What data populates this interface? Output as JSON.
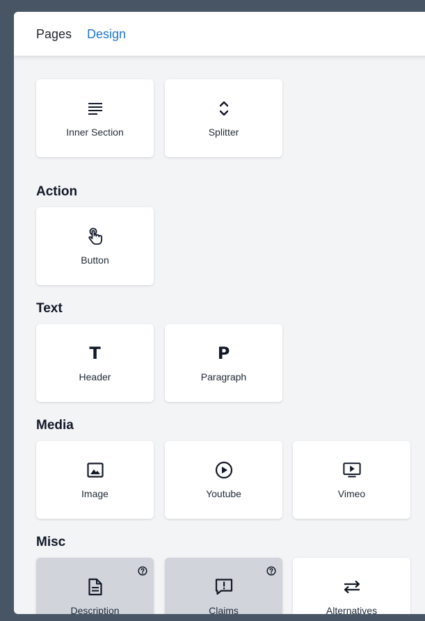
{
  "tabs": {
    "pages": "Pages",
    "design": "Design"
  },
  "colors": {
    "accent": "#1f77d0",
    "card_bg": "#ffffff",
    "card_shaded": "#d1d5db",
    "panel_bg": "#f3f4f6"
  },
  "layout_section": {
    "items": [
      {
        "label": "Inner Section",
        "icon": "lines-icon"
      },
      {
        "label": "Splitter",
        "icon": "expand-vertical-icon"
      }
    ]
  },
  "action_section": {
    "title": "Action",
    "items": [
      {
        "label": "Button",
        "icon": "pointer-hand-icon"
      }
    ]
  },
  "text_section": {
    "title": "Text",
    "items": [
      {
        "label": "Header",
        "icon": "letter-t-icon",
        "glyph": "T"
      },
      {
        "label": "Paragraph",
        "icon": "letter-p-icon",
        "glyph": "P"
      }
    ]
  },
  "media_section": {
    "title": "Media",
    "items": [
      {
        "label": "Image",
        "icon": "image-icon"
      },
      {
        "label": "Youtube",
        "icon": "play-circle-icon"
      },
      {
        "label": "Vimeo",
        "icon": "screen-play-icon"
      }
    ]
  },
  "misc_section": {
    "title": "Misc",
    "items": [
      {
        "label": "Description",
        "icon": "document-icon",
        "has_help": true
      },
      {
        "label": "Claims",
        "icon": "alert-message-icon",
        "has_help": true
      },
      {
        "label": "Alternatives",
        "icon": "swap-arrows-icon",
        "has_help": false
      }
    ]
  }
}
